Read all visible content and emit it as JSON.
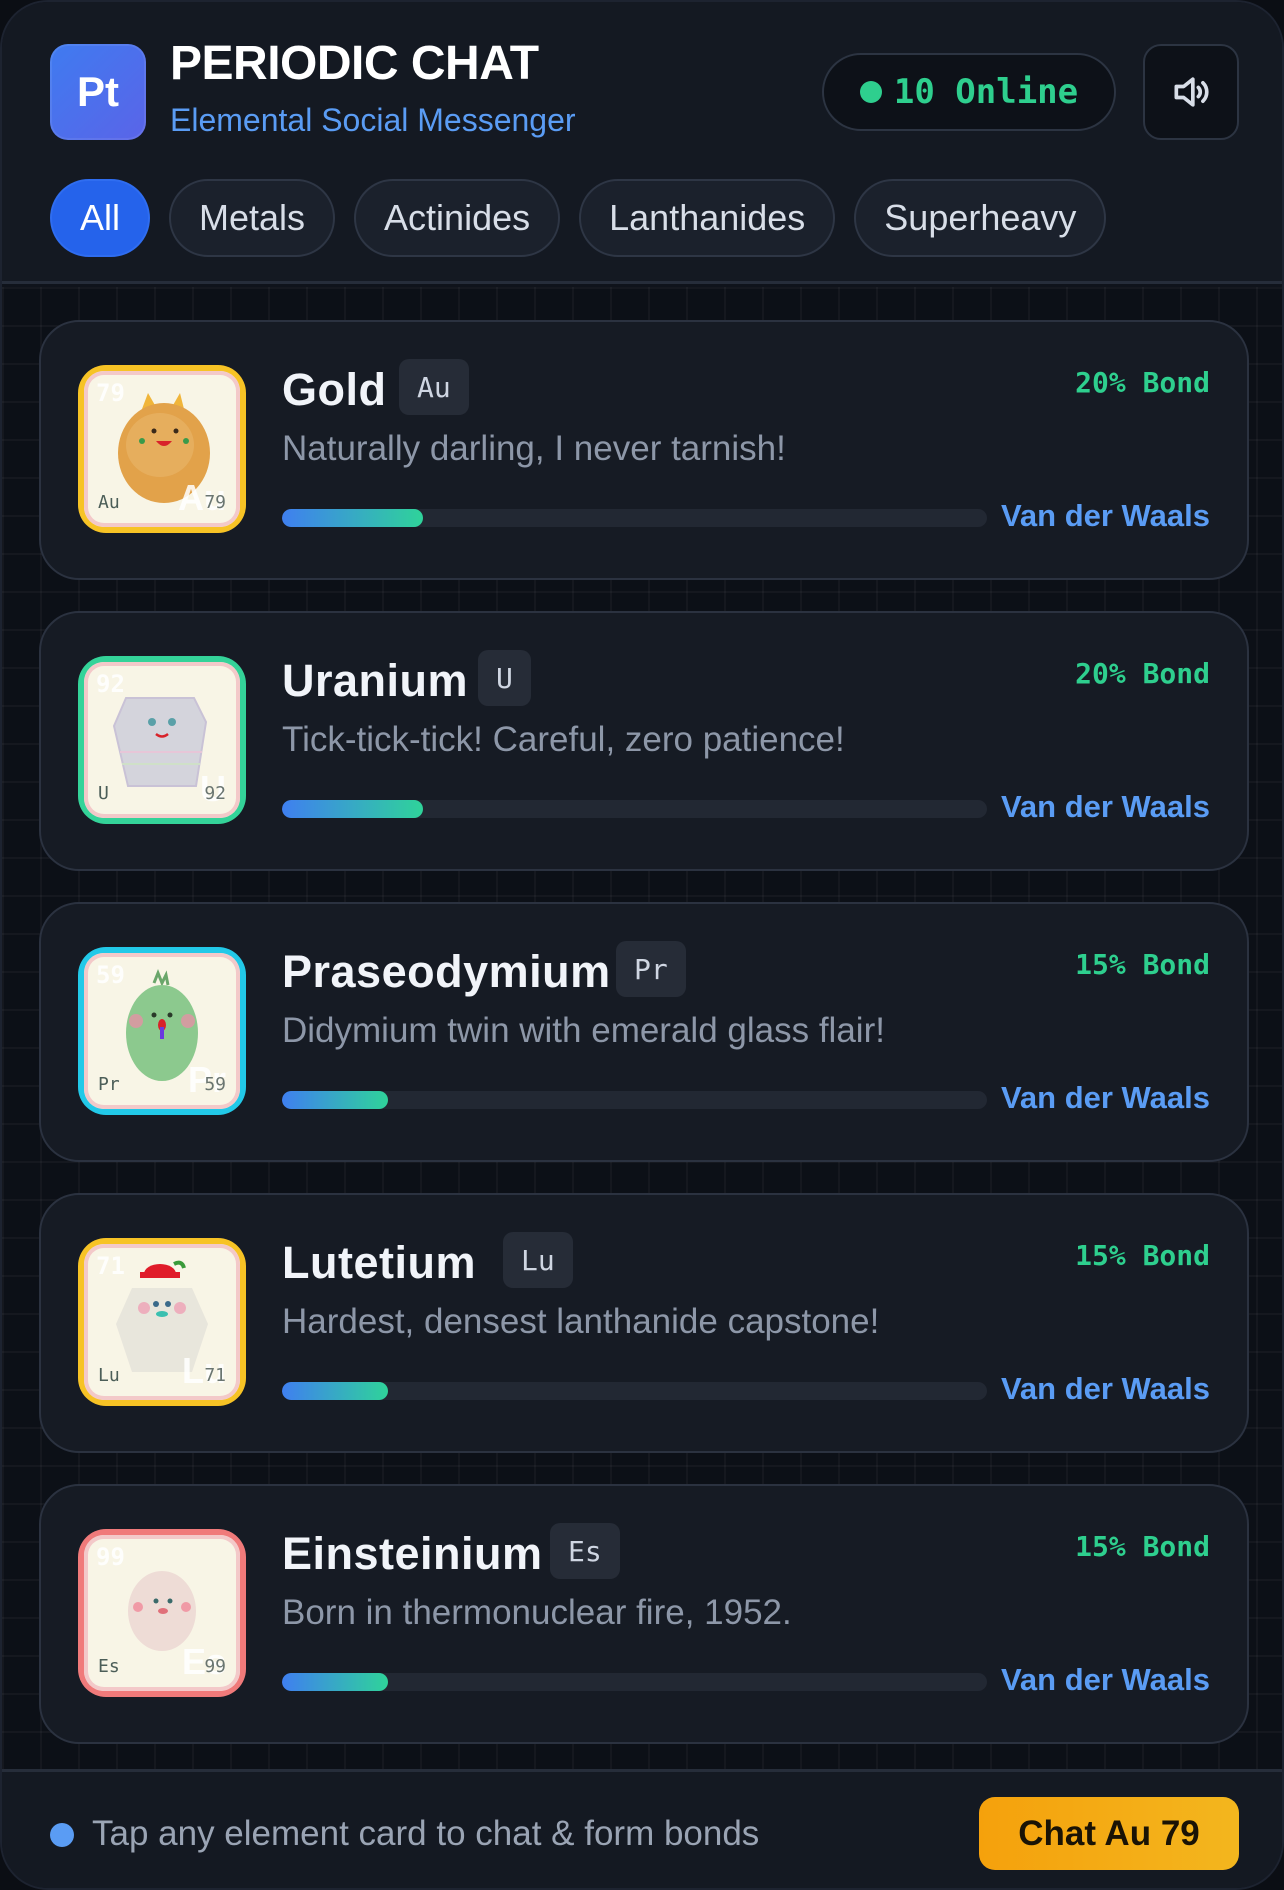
{
  "header": {
    "logo": "Pt",
    "title": "PERIODIC CHAT",
    "subtitle": "Elemental Social Messenger",
    "online": "10 Online",
    "sound_icon": "speaker-icon"
  },
  "tabs": [
    {
      "label": "All",
      "active": true
    },
    {
      "label": "Metals",
      "active": false
    },
    {
      "label": "Actinides",
      "active": false
    },
    {
      "label": "Lanthanides",
      "active": false
    },
    {
      "label": "Superheavy",
      "active": false
    }
  ],
  "elements": [
    {
      "name": "Gold",
      "symbol": "Au",
      "number": "79",
      "message": "Naturally darling, I never tarnish!",
      "bond": "20% Bond",
      "bond_fraction": 0.2,
      "bond_type": "Van der Waals",
      "frame_color": "#f7c325",
      "avatar_big": "Au",
      "avatar_corner": "79"
    },
    {
      "name": "Uranium",
      "symbol": "U",
      "number": "92",
      "message": "Tick-tick-tick! Careful, zero patience!",
      "bond": "20% Bond",
      "bond_fraction": 0.2,
      "bond_type": "Van der Waals",
      "frame_color": "#34d399",
      "avatar_big": "U",
      "avatar_corner": "92"
    },
    {
      "name": "Praseodymium",
      "symbol": "Pr",
      "number": "59",
      "message": "Didymium twin with emerald glass flair!",
      "bond": "15% Bond",
      "bond_fraction": 0.15,
      "bond_type": "Van der Waals",
      "frame_color": "#22c9e8",
      "avatar_big": "Pr",
      "avatar_corner": "59"
    },
    {
      "name": "Lutetium",
      "symbol": "Lu",
      "number": "71",
      "message": "Hardest, densest lanthanide capstone!",
      "bond": "15% Bond",
      "bond_fraction": 0.15,
      "bond_type": "Van der Waals",
      "frame_color": "#f7c325",
      "avatar_big": "Lu",
      "avatar_corner": "71"
    },
    {
      "name": "Einsteinium",
      "symbol": "Es",
      "number": "99",
      "message": "Born in thermonuclear fire, 1952.",
      "bond": "15% Bond",
      "bond_fraction": 0.15,
      "bond_type": "Van der Waals",
      "frame_color": "#f07a7a",
      "avatar_big": "Es",
      "avatar_corner": "99"
    }
  ],
  "footer": {
    "hint": "Tap any element card to chat & form bonds",
    "chat_button": "Chat Au 79"
  }
}
